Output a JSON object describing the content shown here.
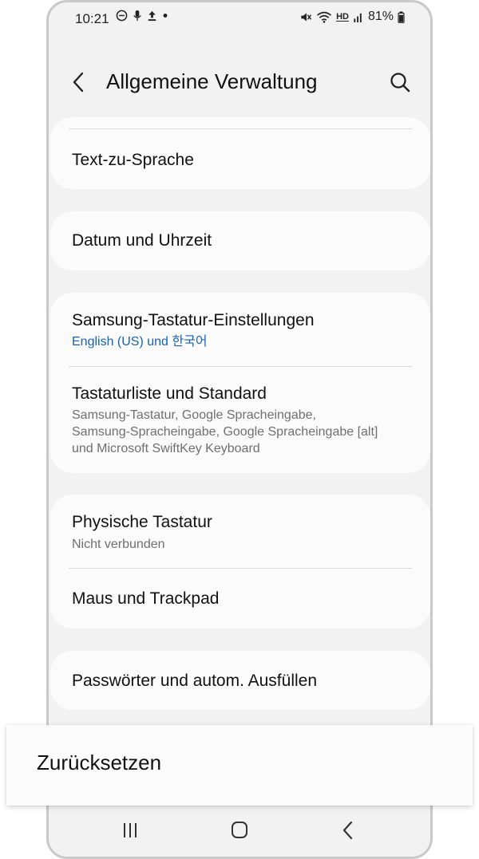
{
  "status_bar": {
    "time": "10:21",
    "battery": "81%",
    "left_icons": [
      "dnd-icon",
      "mic-icon",
      "upload-icon",
      "dot-icon"
    ],
    "right_icons": [
      "mute-icon",
      "wifi-icon",
      "hd-voice-icon",
      "signal-icon",
      "battery-icon"
    ],
    "hd": "HD"
  },
  "header": {
    "title": "Allgemeine Verwaltung"
  },
  "settings": {
    "text_to_speech": "Text-zu-Sprache",
    "date_time": "Datum und Uhrzeit",
    "samsung_keyboard": {
      "title": "Samsung-Tastatur-Einstellungen",
      "subtitle": "English (US) und 한국어"
    },
    "keyboard_list": {
      "title": "Tastaturliste und Standard",
      "subtitle_line1": "Samsung-Tastatur, Google Spracheingabe,",
      "subtitle_line2": "Samsung-Spracheingabe, Google Spracheingabe [alt]",
      "subtitle_line3": "und Microsoft SwiftKey Keyboard"
    },
    "physical_keyboard": {
      "title": "Physische Tastatur",
      "subtitle": "Nicht verbunden"
    },
    "mouse_trackpad": "Maus und Trackpad",
    "passwords_autofill": "Passwörter und autom. Ausfüllen"
  },
  "popup": {
    "label": "Zurücksetzen"
  },
  "colors": {
    "accent": "#1662b8",
    "background": "#f2f2f2",
    "card": "#fbfbfb"
  }
}
